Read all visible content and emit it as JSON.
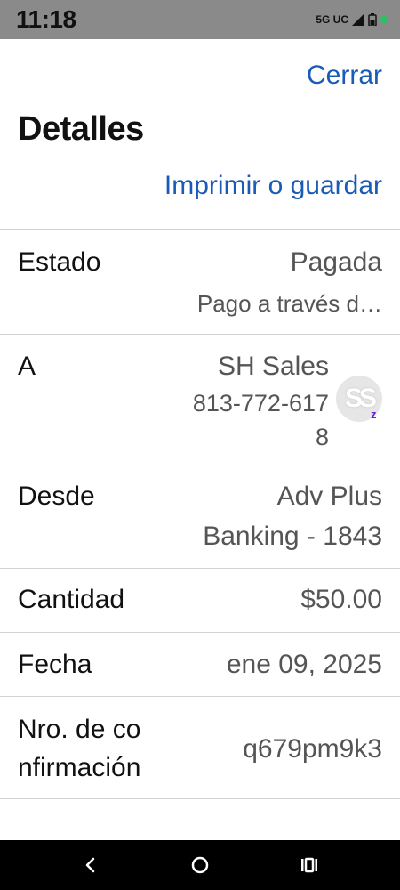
{
  "status_bar": {
    "time": "11:18",
    "network": "5G UC",
    "indicator_color": "#22c55e"
  },
  "header": {
    "close_label": "Cerrar",
    "title": "Detalles",
    "print_label": "Imprimir o guardar",
    "link_color": "#1a5bb5"
  },
  "details": {
    "status": {
      "label": "Estado",
      "value": "Pagada",
      "sub": "Pago a través d…"
    },
    "to": {
      "label": "A",
      "name": "SH Sales",
      "phone_line1": "813-772-617",
      "phone_line2": "8",
      "avatar_initials": "SS",
      "avatar_badge": "z"
    },
    "from": {
      "label": "Desde",
      "value_line1": "Adv Plus",
      "value_line2": "Banking - 1843"
    },
    "amount": {
      "label": "Cantidad",
      "value": "$50.00"
    },
    "date": {
      "label": "Fecha",
      "value": "ene 09, 2025"
    },
    "confirmation": {
      "label_line1": "Nro. de co",
      "label_line2": "nfirmación",
      "value": "q679pm9k3"
    }
  },
  "nav_bar": {
    "icons": [
      "back-icon",
      "home-icon",
      "recents-icon"
    ]
  }
}
